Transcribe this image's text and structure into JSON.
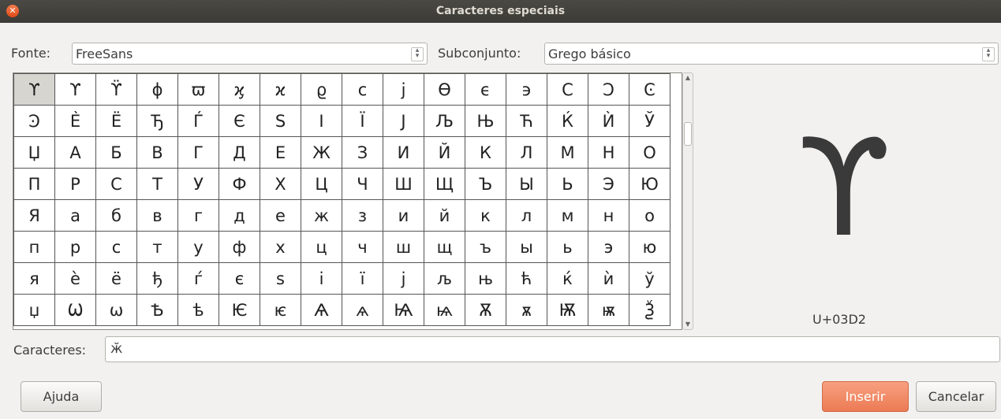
{
  "window": {
    "title": "Caracteres especiais"
  },
  "font": {
    "label": "Fonte:",
    "value": "FreeSans"
  },
  "subset": {
    "label": "Subconjunto:",
    "value": "Grego básico"
  },
  "grid": {
    "rows": [
      [
        "ϒ",
        "ϒ",
        "ϔ",
        "ϕ",
        "ϖ",
        "ϗ",
        "ϰ",
        "ϱ",
        "ϲ",
        "ϳ",
        "ϴ",
        "ϵ",
        "϶",
        "Ϲ",
        "Ͻ",
        "Ͼ"
      ],
      [
        "Ͽ",
        "Ѐ",
        "Ё",
        "Ђ",
        "Ѓ",
        "Є",
        "Ѕ",
        "І",
        "Ї",
        "Ј",
        "Љ",
        "Њ",
        "Ћ",
        "Ќ",
        "Ѝ",
        "Ў"
      ],
      [
        "Џ",
        "А",
        "Б",
        "В",
        "Г",
        "Д",
        "Е",
        "Ж",
        "З",
        "И",
        "Й",
        "К",
        "Л",
        "М",
        "Н",
        "О"
      ],
      [
        "П",
        "Р",
        "С",
        "Т",
        "У",
        "Ф",
        "Х",
        "Ц",
        "Ч",
        "Ш",
        "Щ",
        "Ъ",
        "Ы",
        "Ь",
        "Э",
        "Ю"
      ],
      [
        "Я",
        "а",
        "б",
        "в",
        "г",
        "д",
        "е",
        "ж",
        "з",
        "и",
        "й",
        "к",
        "л",
        "м",
        "н",
        "о"
      ],
      [
        "п",
        "р",
        "с",
        "т",
        "у",
        "ф",
        "х",
        "ц",
        "ч",
        "ш",
        "щ",
        "ъ",
        "ы",
        "ь",
        "э",
        "ю"
      ],
      [
        "я",
        "ѐ",
        "ё",
        "ђ",
        "ѓ",
        "є",
        "ѕ",
        "і",
        "ї",
        "ј",
        "љ",
        "њ",
        "ћ",
        "ќ",
        "ѝ",
        "ў"
      ],
      [
        "џ",
        "Ѡ",
        "ѡ",
        "Ѣ",
        "ѣ",
        "Ѥ",
        "ѥ",
        "Ѧ",
        "ѧ",
        "Ѩ",
        "ѩ",
        "Ѫ",
        "ѫ",
        "Ѭ",
        "ѭ",
        "Ѯ"
      ]
    ],
    "selected": [
      0,
      0
    ]
  },
  "preview": {
    "glyph": "ϒ",
    "code": "U+03D2"
  },
  "characters": {
    "label": "Caracteres:",
    "value": "ӂ"
  },
  "buttons": {
    "help": "Ajuda",
    "insert": "Inserir",
    "cancel": "Cancelar"
  },
  "colors": {
    "accent": "#ec7a55",
    "titlebar": "#3c3b37"
  }
}
